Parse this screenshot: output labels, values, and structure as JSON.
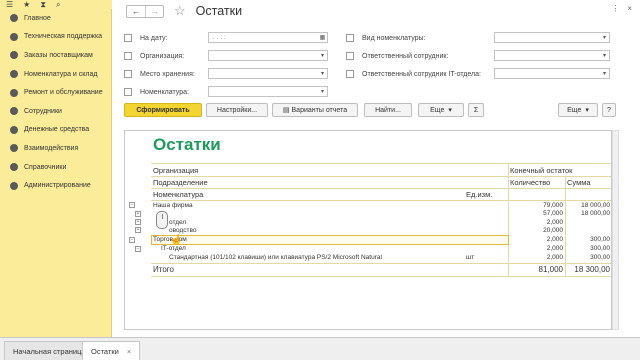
{
  "topstrip": {
    "icons": [
      "☰",
      "★",
      "⧗",
      "⌕"
    ]
  },
  "sidebar": {
    "items": [
      {
        "label": "Главное"
      },
      {
        "label": "Техническая поддержка"
      },
      {
        "label": "Заказы поставщикам"
      },
      {
        "label": "Номенклатура и склад"
      },
      {
        "label": "Ремонт и обслуживание"
      },
      {
        "label": "Сотрудники"
      },
      {
        "label": "Денежные средства"
      },
      {
        "label": "Взаимодействия"
      },
      {
        "label": "Справочники"
      },
      {
        "label": "Администрирование"
      }
    ]
  },
  "window": {
    "title": "Остатки",
    "nav_back": "←",
    "nav_forward": "→",
    "star": "☆",
    "menu_dots": "⋮",
    "close": "×"
  },
  "filters": {
    "date_label": "На дату:",
    "date_placeholder": ". . : :",
    "org_label": "Организация:",
    "storage_label": "Место хранения:",
    "nomenclature_label": "Номенклатура:",
    "nomenclature_type_label": "Вид номенклатуры:",
    "responsible_label": "Ответственный сотрудник:",
    "responsible_it_label": "Ответственный сотрудник IT-отдела:"
  },
  "toolbar": {
    "generate": "Сформировать",
    "settings": "Настройки...",
    "variants": "Варианты отчета",
    "find": "Найти...",
    "more": "Еще",
    "sum": "Σ",
    "more_right": "Еще",
    "help": "?"
  },
  "report": {
    "title": "Остатки",
    "header": {
      "org": "Организация",
      "dept": "Подразделение",
      "nomen": "Номенклатура",
      "unit": "Ед.изм.",
      "final": "Конечный остаток",
      "qty": "Количество",
      "sum": "Сумма"
    },
    "rows": [
      {
        "label": "Наша фирма",
        "unit": "",
        "qty": "79,000",
        "sum": "18 000,00"
      },
      {
        "label": "",
        "unit": "",
        "qty": "57,000",
        "sum": "18 000,00"
      },
      {
        "label": "отдел",
        "unit": "",
        "qty": "2,000",
        "sum": ""
      },
      {
        "label": "оводство",
        "unit": "",
        "qty": "20,000",
        "sum": ""
      },
      {
        "label": "Торгов дом",
        "unit": "",
        "qty": "2,000",
        "sum": "300,00"
      },
      {
        "label": "IT-отдел",
        "unit": "",
        "qty": "2,000",
        "sum": "300,00"
      },
      {
        "label": "Стандартная (101/102 клавиши) или клавиатура PS/2 Microsoft Natural",
        "unit": "шт",
        "qty": "2,000",
        "sum": "300,00"
      }
    ],
    "total": {
      "label": "Итого",
      "qty": "81,000",
      "sum": "18 300,00"
    }
  },
  "tabs": [
    {
      "label": "Начальная страница"
    },
    {
      "label": "Остатки",
      "close": "×"
    }
  ]
}
